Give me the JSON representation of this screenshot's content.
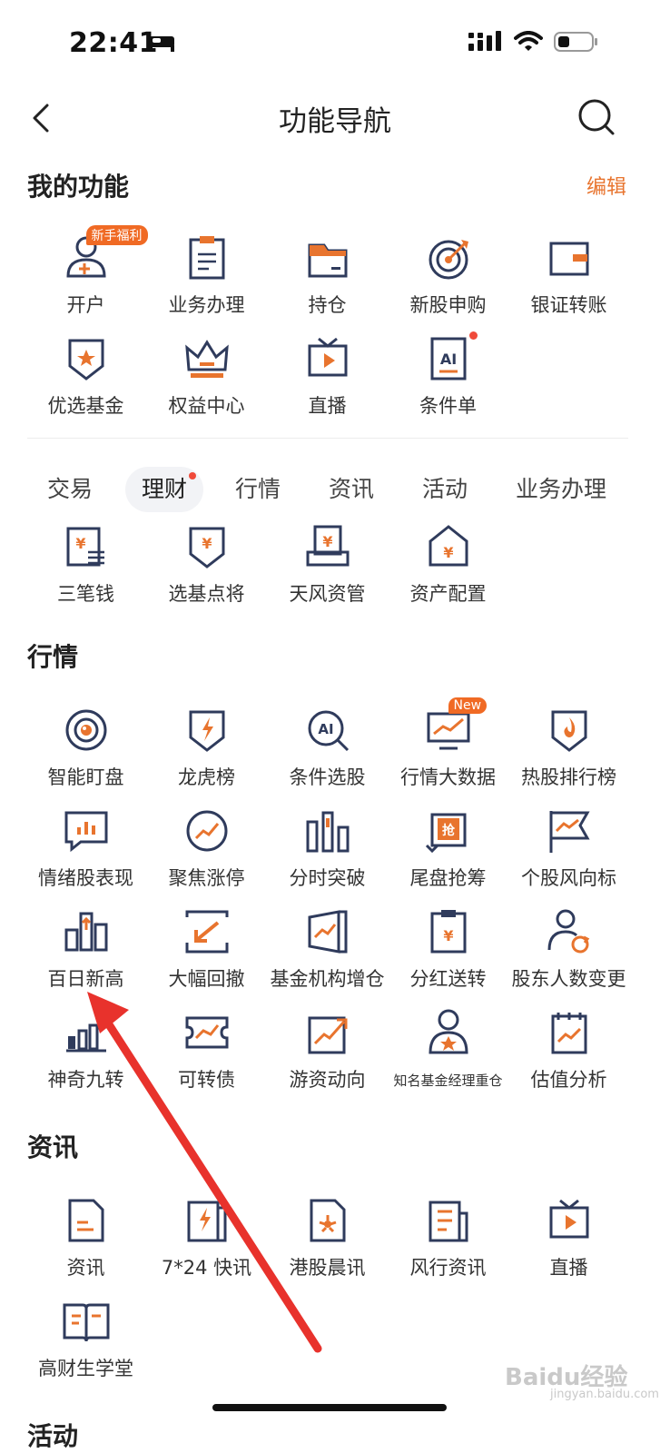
{
  "status": {
    "time": "22:41"
  },
  "nav": {
    "title": "功能导航"
  },
  "my_functions": {
    "title": "我的功能",
    "edit_label": "编辑",
    "items": [
      {
        "label": "开户",
        "icon": "account-open-icon",
        "tag": "新手福利"
      },
      {
        "label": "业务办理",
        "icon": "clipboard-icon"
      },
      {
        "label": "持仓",
        "icon": "folder-icon"
      },
      {
        "label": "新股申购",
        "icon": "target-icon"
      },
      {
        "label": "银证转账",
        "icon": "wallet-icon"
      },
      {
        "label": "优选基金",
        "icon": "star-shield-icon"
      },
      {
        "label": "权益中心",
        "icon": "crown-icon"
      },
      {
        "label": "直播",
        "icon": "tv-play-icon"
      },
      {
        "label": "条件单",
        "icon": "ai-doc-icon",
        "dot": true
      }
    ]
  },
  "tabs": {
    "items": [
      "交易",
      "理财",
      "行情",
      "资讯",
      "活动",
      "业务办理"
    ],
    "active": "理财"
  },
  "wealth": {
    "items": [
      {
        "label": "三笔钱",
        "icon": "yen-list-icon"
      },
      {
        "label": "选基点将",
        "icon": "yen-shield-icon"
      },
      {
        "label": "天风资管",
        "icon": "yen-box-icon"
      },
      {
        "label": "资产配置",
        "icon": "yen-house-icon"
      }
    ]
  },
  "market": {
    "title": "行情",
    "items": [
      {
        "label": "智能盯盘",
        "icon": "eye-target-icon"
      },
      {
        "label": "龙虎榜",
        "icon": "lightning-shield-icon"
      },
      {
        "label": "条件选股",
        "icon": "ai-search-icon"
      },
      {
        "label": "行情大数据",
        "icon": "monitor-chart-icon",
        "tag": "New"
      },
      {
        "label": "热股排行榜",
        "icon": "fire-shield-icon"
      },
      {
        "label": "情绪股表现",
        "icon": "chat-bars-icon"
      },
      {
        "label": "聚焦涨停",
        "icon": "clock-trend-icon"
      },
      {
        "label": "分时突破",
        "icon": "bars-icon"
      },
      {
        "label": "尾盘抢筹",
        "icon": "grab-icon"
      },
      {
        "label": "个股风向标",
        "icon": "flag-icon"
      },
      {
        "label": "百日新高",
        "icon": "building-up-icon"
      },
      {
        "label": "大幅回撤",
        "icon": "down-arrow-box-icon"
      },
      {
        "label": "基金机构增仓",
        "icon": "trend-box-icon"
      },
      {
        "label": "分红送转",
        "icon": "yen-clip-icon"
      },
      {
        "label": "股东人数变更",
        "icon": "user-refresh-icon"
      },
      {
        "label": "神奇九转",
        "icon": "coin-bars-icon"
      },
      {
        "label": "可转债",
        "icon": "ticket-icon"
      },
      {
        "label": "游资动向",
        "icon": "up-trend-icon"
      },
      {
        "label": "知名基金经理重仓",
        "icon": "manager-star-icon",
        "small": true
      },
      {
        "label": "估值分析",
        "icon": "note-trend-icon"
      }
    ]
  },
  "news": {
    "title": "资讯",
    "items": [
      {
        "label": "资讯",
        "icon": "document-icon"
      },
      {
        "label": "7*24 快讯",
        "icon": "flash-news-icon"
      },
      {
        "label": "港股晨讯",
        "icon": "hk-flower-icon"
      },
      {
        "label": "风行资讯",
        "icon": "newspaper-icon"
      },
      {
        "label": "直播",
        "icon": "tv-play-icon"
      },
      {
        "label": "高财生学堂",
        "icon": "open-book-icon"
      }
    ]
  },
  "activity": {
    "title": "活动"
  },
  "watermark": {
    "brand": "Baidu经验",
    "sub": "jingyan.baidu.com"
  },
  "colors": {
    "accent": "#e8742e",
    "icon_dark": "#2f3b5c",
    "arrow": "#e8322c"
  }
}
